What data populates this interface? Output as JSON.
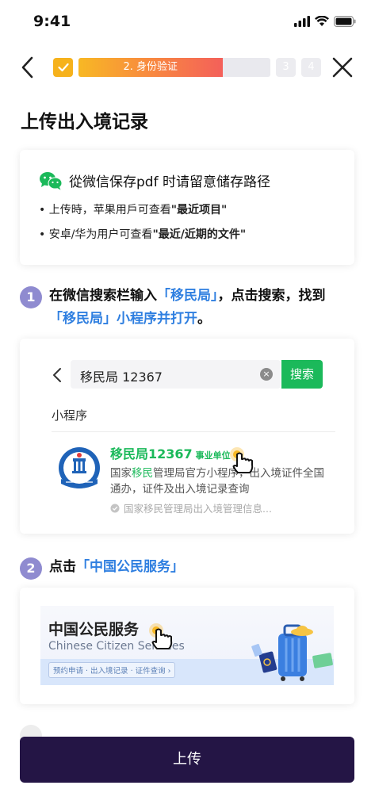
{
  "status": {
    "time": "9:41"
  },
  "nav": {
    "progress_label": "2. 身份验证",
    "progress": 0.75,
    "step3": "3",
    "step4": "4"
  },
  "page_title": "上传出入境记录",
  "tip": {
    "heading": "從微信保存pdf 时请留意储存路径",
    "line1_prefix": "• 上传時，苹果用戶可查看",
    "line1_bold": "\"最近项目\"",
    "line2_prefix": "• 安卓/华为用户可查看",
    "line2_bold": "\"最近/近期的文件\""
  },
  "step1": {
    "num": "1",
    "text_a": "在微信搜索栏输入",
    "highlight_a": "「移民局」",
    "text_b": "，点击搜索，找到",
    "highlight_b": "「移民局」小程序并打开",
    "text_c": "。"
  },
  "search_demo": {
    "query": "移民局 12367",
    "clear": "×",
    "button": "搜索",
    "section_label": "小程序",
    "app_name": "移民局12367",
    "app_tag": "事业单位",
    "desc_a": "国家",
    "desc_hl": "移民",
    "desc_b": "管理局官方小程序，出入境证件全国通办，证件及出入境记录查询",
    "source": "国家移民管理局出入境管理信息..."
  },
  "step2": {
    "num": "2",
    "text_a": "点击",
    "highlight": "「中国公民服务」"
  },
  "banner": {
    "title": "中国公民服务",
    "subtitle": "Chinese Citizen Services",
    "link": "预约申请 · 出入境记录 · 证件查询 ›"
  },
  "upload_button": "上传",
  "colors": {
    "accent_dark": "#241545",
    "step_badge": "#8f8bd0",
    "link_blue": "#2f7fe0",
    "wechat_green": "#1bb95a",
    "progress_start": "#f8b824",
    "progress_end": "#f4605a"
  }
}
